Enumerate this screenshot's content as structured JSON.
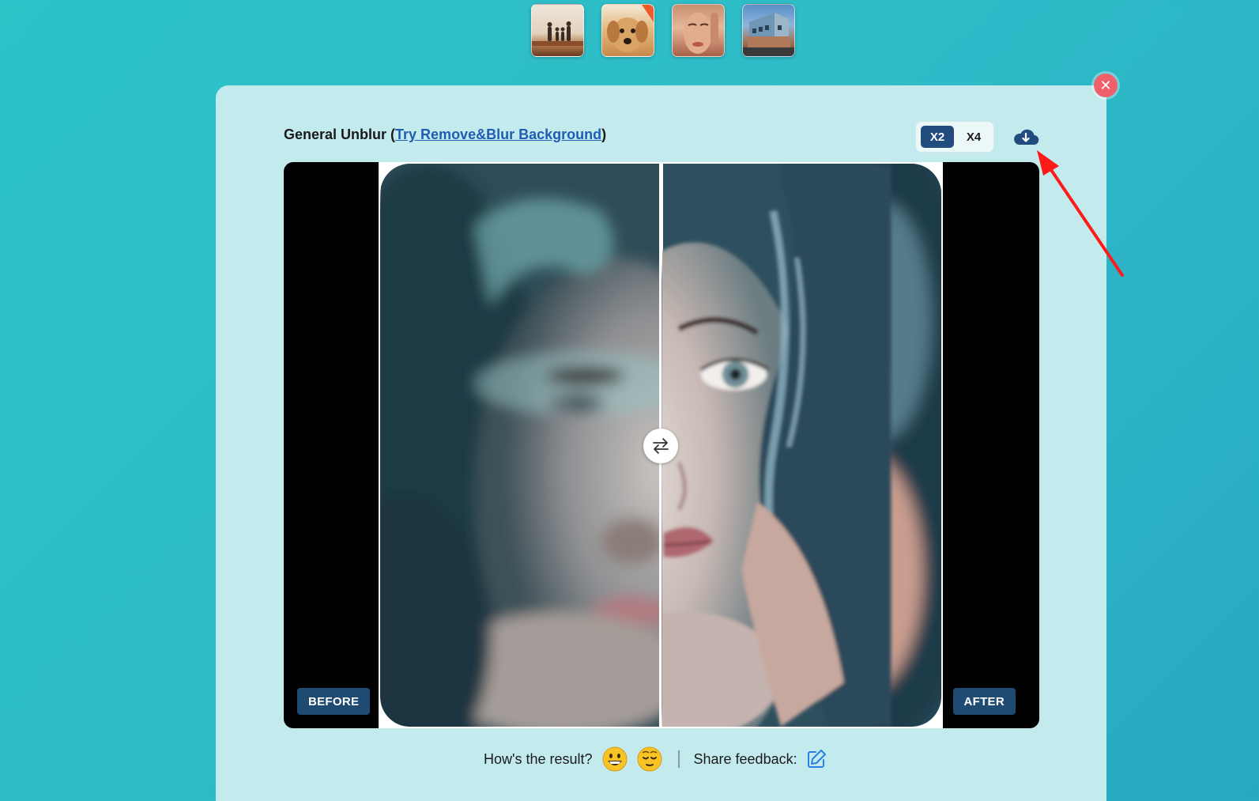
{
  "samples": [
    {
      "name": "family-on-pier"
    },
    {
      "name": "golden-retriever-puppy"
    },
    {
      "name": "woman-portrait"
    },
    {
      "name": "modern-building"
    }
  ],
  "header": {
    "title_prefix": "General Unblur (",
    "link_text": "Try Remove&Blur Background",
    "title_suffix": ")"
  },
  "scale": {
    "options": [
      "X2",
      "X4"
    ],
    "selected": "X2"
  },
  "viewer": {
    "before_label": "BEFORE",
    "after_label": "AFTER",
    "split_fraction": 0.5
  },
  "feedback": {
    "question": "How's the result?",
    "share_label": "Share feedback:"
  },
  "colors": {
    "background": "#2cc3c9",
    "card": "#c3ebee",
    "accent": "#224c7e",
    "close": "#f0606a",
    "link": "#1f5db3",
    "annotation": "#ff1a1a"
  },
  "icons": {
    "close": "close-icon",
    "download": "cloud-download-icon",
    "swap": "swap-arrows-icon",
    "happy": "grinning-face-icon",
    "unhappy": "relieved-face-icon",
    "edit": "edit-pencil-icon"
  }
}
